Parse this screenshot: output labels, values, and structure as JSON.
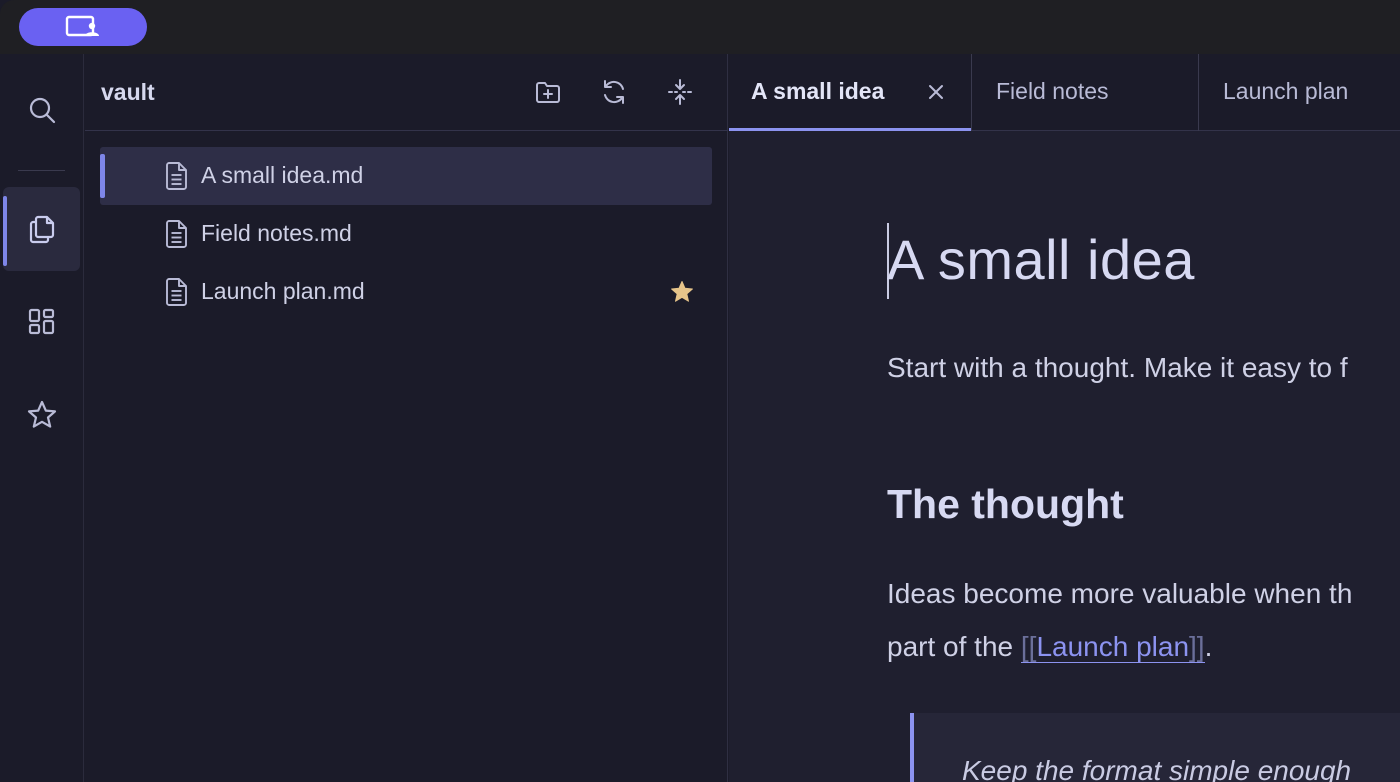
{
  "colors": {
    "accent": "#8c93f0",
    "pill": "#6a61f2",
    "star": "#e6c48a",
    "background": "#1b1b29",
    "editor_background": "#1f1f2f"
  },
  "titlebar": {
    "pill_icon": "screen-share-user-icon"
  },
  "ribbon": {
    "items": [
      {
        "icon": "search-icon"
      },
      {
        "icon": "files-icon",
        "active": true
      },
      {
        "icon": "grid-icon"
      },
      {
        "icon": "star-icon"
      }
    ]
  },
  "explorer": {
    "title": "vault",
    "actions": [
      {
        "icon": "new-folder-icon"
      },
      {
        "icon": "refresh-icon"
      },
      {
        "icon": "collapse-icon"
      }
    ],
    "files": [
      {
        "label": "A small idea.md",
        "active": true,
        "starred": false
      },
      {
        "label": "Field notes.md",
        "active": false,
        "starred": false
      },
      {
        "label": "Launch plan.md",
        "active": false,
        "starred": true
      }
    ]
  },
  "tabs": [
    {
      "label": "A small idea",
      "active": true
    },
    {
      "label": "Field notes",
      "active": false
    },
    {
      "label": "Launch plan",
      "active": false
    }
  ],
  "document": {
    "title": "A small idea",
    "paragraph1": "Start with a thought. Make it easy to f",
    "heading2": "The thought",
    "paragraph2_line1": "Ideas become more valuable when th",
    "paragraph2_line2_prefix": "part of the ",
    "link_open": "[[",
    "link_text": "Launch plan",
    "link_close": "]]",
    "paragraph2_line2_suffix": ".",
    "quote": "Keep the format simple enough"
  }
}
